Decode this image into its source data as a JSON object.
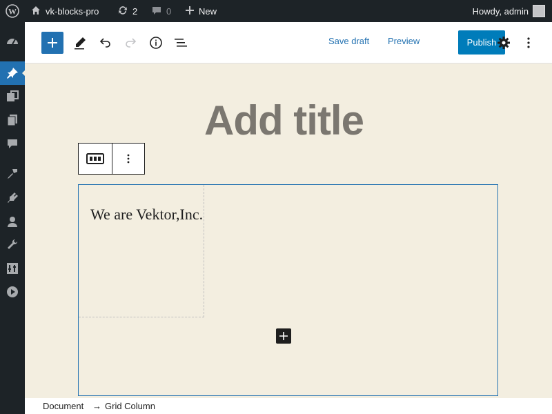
{
  "admin_bar": {
    "site_name": "vk-blocks-pro",
    "updates_count": "2",
    "comments_count": "0",
    "new_label": "New",
    "greeting": "Howdy, admin"
  },
  "sidebar": {
    "items": [
      {
        "icon": "dashboard-icon"
      },
      {
        "icon": "pin-icon",
        "active": true
      },
      {
        "icon": "media-icon"
      },
      {
        "icon": "pages-icon"
      },
      {
        "icon": "comments-icon"
      },
      {
        "icon": "appearance-icon"
      },
      {
        "icon": "plugins-icon"
      },
      {
        "icon": "users-icon"
      },
      {
        "icon": "tools-icon"
      },
      {
        "icon": "settings-icon"
      },
      {
        "icon": "play-icon"
      }
    ]
  },
  "toolbar": {
    "save_draft_label": "Save draft",
    "preview_label": "Preview",
    "publish_label": "Publish",
    "accent": "#007cba"
  },
  "editor": {
    "title_placeholder": "Add title",
    "column_text": "We are Vektor,Inc."
  },
  "breadcrumb": {
    "items": [
      "Document",
      "Grid Column"
    ],
    "separator": "→"
  }
}
